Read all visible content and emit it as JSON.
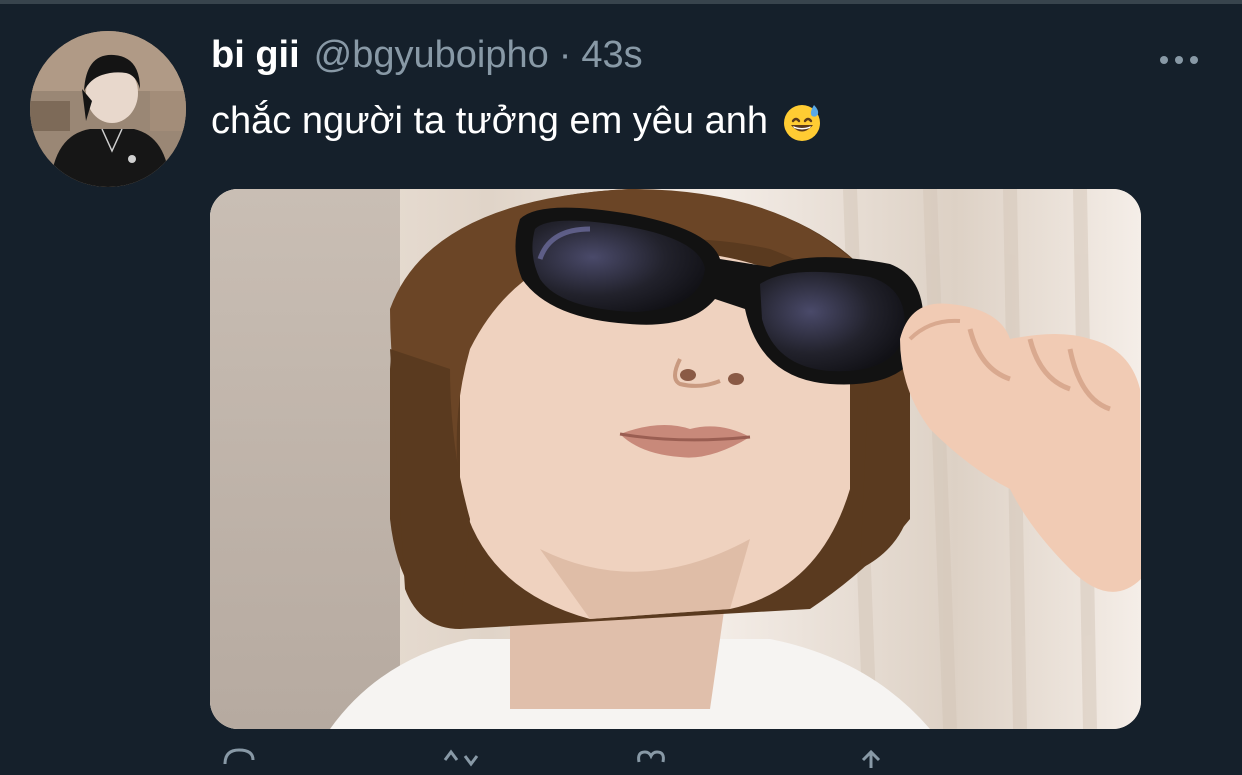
{
  "tweet": {
    "display_name": "bi gii",
    "handle": "@bgyuboipho",
    "separator": "·",
    "timestamp": "43s",
    "text": "chắc người ta tưởng em yêu anh",
    "emoji": "grinning-face-with-sweat-icon"
  },
  "icons": {
    "more": "more-horizontal-icon",
    "reply": "reply-icon",
    "retweet": "retweet-icon",
    "like": "like-icon",
    "share": "share-icon"
  },
  "colors": {
    "background": "#15202b",
    "secondary_text": "#8899a6",
    "primary_text": "#ffffff",
    "divider": "#38444d"
  }
}
